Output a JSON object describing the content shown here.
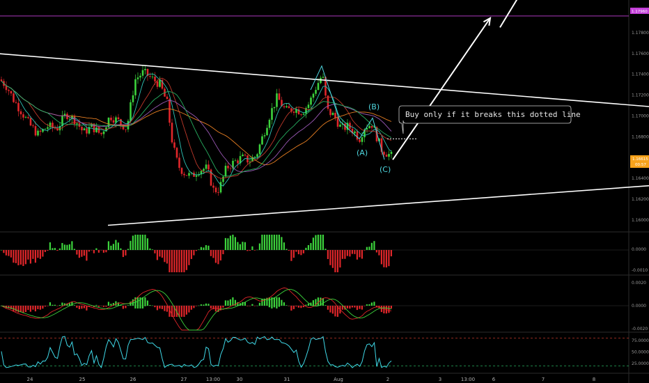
{
  "chart_data": [
    {
      "type": "candlestick",
      "panel": "price",
      "ylim": [
        1.159,
        1.181
      ],
      "price_ticks": [
        "1.17960",
        "1.17800",
        "1.17600",
        "1.17400",
        "1.17200",
        "1.17000",
        "1.16800",
        "1.16600",
        "1.16400",
        "1.16200",
        "1.16000"
      ],
      "price_tick_values": [
        1.1796,
        1.178,
        1.176,
        1.174,
        1.172,
        1.17,
        1.168,
        1.166,
        1.164,
        1.162,
        1.16
      ],
      "horizontal_line": {
        "label": "1.17960",
        "value": 1.1796,
        "color": "#c43fd9"
      },
      "current_price": {
        "label": "1.16615",
        "countdown": "00:57",
        "value": 1.16615,
        "color": "#f7a21b"
      },
      "close_path": [
        [
          0,
          1.1735
        ],
        [
          10,
          1.1728
        ],
        [
          20,
          1.1715
        ],
        [
          30,
          1.1705
        ],
        [
          42,
          1.1692
        ],
        [
          55,
          1.1682
        ],
        [
          68,
          1.169
        ],
        [
          82,
          1.1688
        ],
        [
          95,
          1.1702
        ],
        [
          108,
          1.1696
        ],
        [
          120,
          1.1684
        ],
        [
          132,
          1.169
        ],
        [
          145,
          1.1682
        ],
        [
          158,
          1.17
        ],
        [
          170,
          1.1695
        ],
        [
          182,
          1.1688
        ],
        [
          194,
          1.1735
        ],
        [
          206,
          1.1742
        ],
        [
          218,
          1.1736
        ],
        [
          230,
          1.173
        ],
        [
          240,
          1.1712
        ],
        [
          248,
          1.1672
        ],
        [
          256,
          1.1652
        ],
        [
          265,
          1.1645
        ],
        [
          275,
          1.1642
        ],
        [
          285,
          1.1648
        ],
        [
          297,
          1.165
        ],
        [
          307,
          1.1628
        ],
        [
          315,
          1.163
        ],
        [
          325,
          1.165
        ],
        [
          335,
          1.1655
        ],
        [
          347,
          1.166
        ],
        [
          358,
          1.1657
        ],
        [
          368,
          1.1662
        ],
        [
          378,
          1.1682
        ],
        [
          388,
          1.1702
        ],
        [
          398,
          1.1718
        ],
        [
          410,
          1.1705
        ],
        [
          422,
          1.1707
        ],
        [
          434,
          1.1704
        ],
        [
          444,
          1.1712
        ],
        [
          454,
          1.1728
        ],
        [
          463,
          1.174
        ],
        [
          470,
          1.1705
        ],
        [
          480,
          1.17
        ],
        [
          490,
          1.1688
        ],
        [
          500,
          1.169
        ],
        [
          510,
          1.1684
        ],
        [
          516,
          1.1678
        ],
        [
          524,
          1.169
        ],
        [
          534,
          1.1692
        ],
        [
          541,
          1.168
        ],
        [
          548,
          1.1668
        ],
        [
          556,
          1.1664
        ],
        [
          562,
          1.16615
        ]
      ],
      "indicators": [
        {
          "name": "MA fast",
          "color": "#2ec4b6"
        },
        {
          "name": "MA slow",
          "color": "#c0392b"
        },
        {
          "name": "MA long",
          "color": "#e67e22"
        },
        {
          "name": "MA purple",
          "color": "#9b59b6"
        },
        {
          "name": "MA green",
          "color": "#27ae60"
        }
      ],
      "trendlines": [
        {
          "name": "upper",
          "points": [
            [
              -5,
              1.176
            ],
            [
              932,
              1.1709
            ]
          ],
          "color": "#ffffff"
        },
        {
          "name": "lower",
          "points": [
            [
              155,
              1.1595
            ],
            [
              932,
              1.1633
            ]
          ],
          "color": "#ffffff"
        },
        {
          "name": "cyan-wave",
          "points": [
            [
              446,
              1.1725
            ],
            [
              462,
              1.1748
            ],
            [
              488,
              1.1695
            ],
            [
              516,
              1.1678
            ],
            [
              535,
              1.1698
            ],
            [
              552,
              1.1658
            ]
          ],
          "color": "#4fd8e0"
        },
        {
          "name": "dotted-breakout",
          "points": [
            [
              556,
              1.1678
            ],
            [
              600,
              1.1678
            ]
          ],
          "color": "#ffffff",
          "dash": true
        }
      ],
      "arrows": [
        {
          "points": [
            [
              564,
              1.1658
            ],
            [
              704,
              1.1794
            ]
          ]
        },
        {
          "points": [
            [
              718,
              1.1785
            ],
            [
              748,
              1.1818
            ]
          ]
        }
      ],
      "wave_labels": [
        "(A)",
        "(B)",
        "(C)"
      ],
      "annotation": "Buy only if it breaks this dotted line"
    },
    {
      "type": "bar",
      "panel": "oscillator-1",
      "ticks": [
        "0.0000",
        "-0.0010"
      ],
      "colors": {
        "positive": "#3cd33c",
        "negative": "#e0262a"
      }
    },
    {
      "type": "bar+line",
      "panel": "macd",
      "ticks": [
        "0.0020",
        "0.0000",
        "-0.0020"
      ],
      "colors": {
        "positive": "#3cd33c",
        "negative": "#e0262a",
        "macd": "#e0262a",
        "signal": "#3cd33c"
      }
    },
    {
      "type": "line",
      "panel": "stochastic",
      "ticks": [
        "75.0000",
        "50.0000",
        "25.0000"
      ],
      "levels": [
        80,
        20
      ],
      "color": "#3fd9e8"
    }
  ],
  "x_axis": {
    "labels": [
      "24",
      "25",
      "26",
      "27",
      "13:00",
      "30",
      "31",
      "Aug",
      "2",
      "3",
      "13:00",
      "6",
      "7",
      "8"
    ],
    "positions": [
      43,
      118,
      191,
      264,
      306,
      344,
      412,
      486,
      557,
      632,
      672,
      709,
      780,
      853
    ]
  }
}
